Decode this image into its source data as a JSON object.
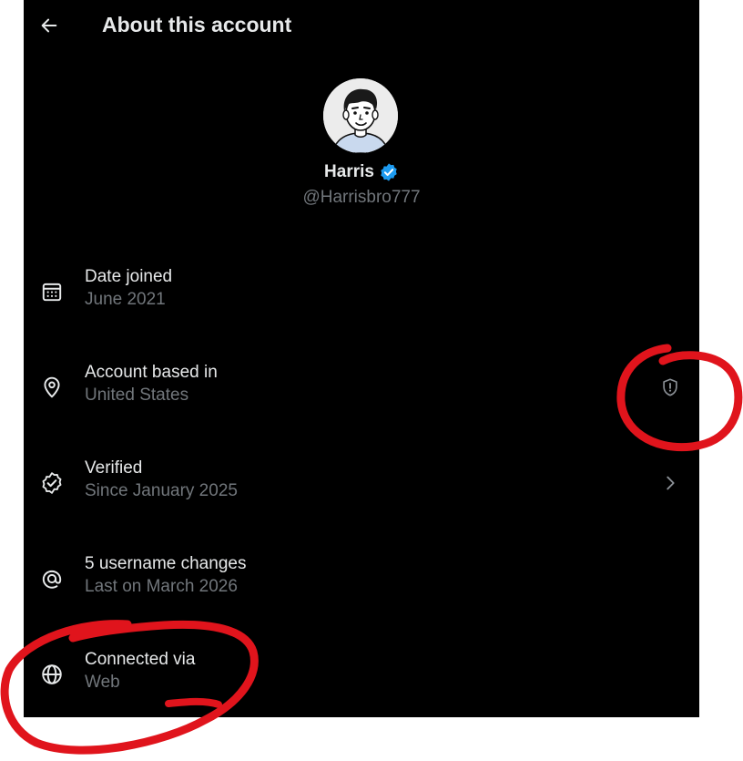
{
  "header": {
    "title": "About this account",
    "back_icon": "arrow-left-icon"
  },
  "profile": {
    "display_name": "Harris",
    "handle": "@Harrisbro777",
    "verified_badge_color": "#1d9bf0",
    "avatar_icon": "cartoon-avatar"
  },
  "rows": [
    {
      "title": "Date joined",
      "subtitle": "June 2021",
      "icon": "calendar-icon"
    },
    {
      "title": "Account based in",
      "subtitle": "United States",
      "icon": "location-pin-icon",
      "trailing_icon": "shield-alert-icon"
    },
    {
      "title": "Verified",
      "subtitle": "Since January 2025",
      "icon": "verified-check-icon",
      "trailing_icon": "chevron-right-icon"
    },
    {
      "title": "5 username changes",
      "subtitle": "Last on March 2026",
      "icon": "at-sign-icon"
    },
    {
      "title": "Connected via",
      "subtitle": "Web",
      "icon": "globe-icon"
    }
  ],
  "colors": {
    "background": "#000000",
    "primary_text": "#e7e9ea",
    "secondary_text": "#71767b",
    "annotation": "#e0141c"
  }
}
